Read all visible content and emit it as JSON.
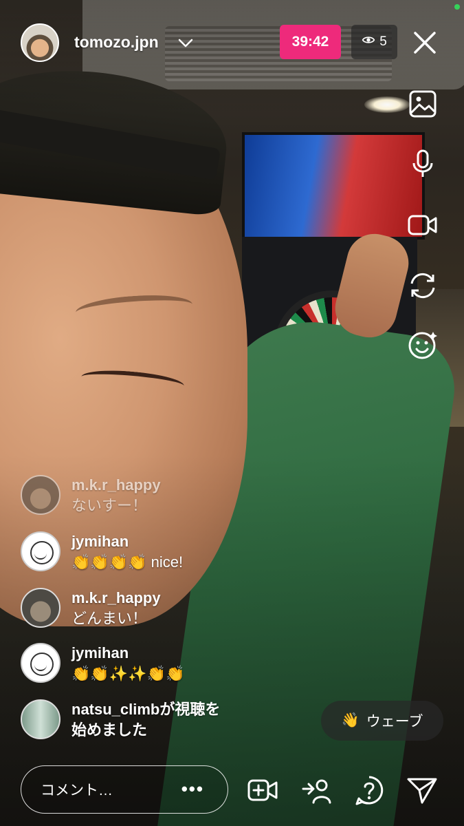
{
  "header": {
    "host_username": "tomozo.jpn",
    "live_timer": "39:42",
    "viewer_count": "5"
  },
  "icons": {
    "side_toolbar": [
      "image-icon",
      "microphone-icon",
      "video-camera-icon",
      "flip-camera-icon",
      "face-effects-icon"
    ],
    "bottom_bar": [
      "add-guest-video-icon",
      "invite-user-icon",
      "question-icon",
      "share-send-icon"
    ]
  },
  "comments": [
    {
      "user": "m.k.r_happy",
      "text": "ないすー！"
    },
    {
      "user": "jymihan",
      "text": "👏👏👏👏 nice!"
    },
    {
      "user": "m.k.r_happy",
      "text": "どんまい！"
    },
    {
      "user": "jymihan",
      "text": "👏👏✨✨👏👏"
    },
    {
      "user": "natsu_climb",
      "text": "が視聴を",
      "text_line2": "始めました"
    }
  ],
  "wave_button": {
    "label": "ウェーブ",
    "emoji": "👋"
  },
  "comment_box": {
    "placeholder": "コメント…",
    "more": "•••"
  },
  "colors": {
    "live_badge": "#ee2a7b",
    "viewer_badge": "#282828",
    "online_dot": "#36d15a"
  }
}
